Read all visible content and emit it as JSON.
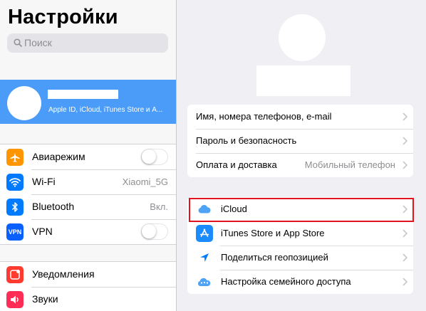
{
  "sidebar": {
    "title": "Настройки",
    "search": {
      "placeholder": "Поиск"
    },
    "profile": {
      "subtitle": "Apple ID, iCloud, iTunes Store и A..."
    },
    "connectivity": [
      {
        "label": "Авиарежим",
        "icon": "airplane-icon",
        "color": "#ff9500",
        "toggle": false
      },
      {
        "label": "Wi-Fi",
        "icon": "wifi-icon",
        "color": "#007aff",
        "value": "Xiaomi_5G"
      },
      {
        "label": "Bluetooth",
        "icon": "bluetooth-icon",
        "color": "#007aff",
        "value": "Вкл."
      },
      {
        "label": "VPN",
        "icon": "vpn-icon",
        "icon_text": "VPN",
        "color": "#0a60ff",
        "toggle": false
      }
    ],
    "notifications": [
      {
        "label": "Уведомления",
        "icon": "notifications-icon",
        "color": "#ff3b30"
      },
      {
        "label": "Звуки",
        "icon": "sounds-icon",
        "color": "#ff2d55"
      }
    ]
  },
  "main": {
    "account": [
      {
        "label": "Имя, номера телефонов, e-mail"
      },
      {
        "label": "Пароль и безопасность"
      },
      {
        "label": "Оплата и доставка",
        "value": "Мобильный телефон"
      }
    ],
    "services": [
      {
        "label": "iCloud",
        "icon": "icloud-icon",
        "color": "#ffffff",
        "highlighted": true
      },
      {
        "label": "iTunes Store и App Store",
        "icon": "app-store-icon",
        "color": "#1a8cff"
      },
      {
        "label": "Поделиться геопозицией",
        "icon": "location-icon",
        "color": "#007aff"
      },
      {
        "label": "Настройка семейного доступа",
        "icon": "family-icon",
        "color": "#ffffff"
      }
    ]
  },
  "colors": {
    "accent": "#4b9cf8",
    "highlight": "#e3121f"
  }
}
